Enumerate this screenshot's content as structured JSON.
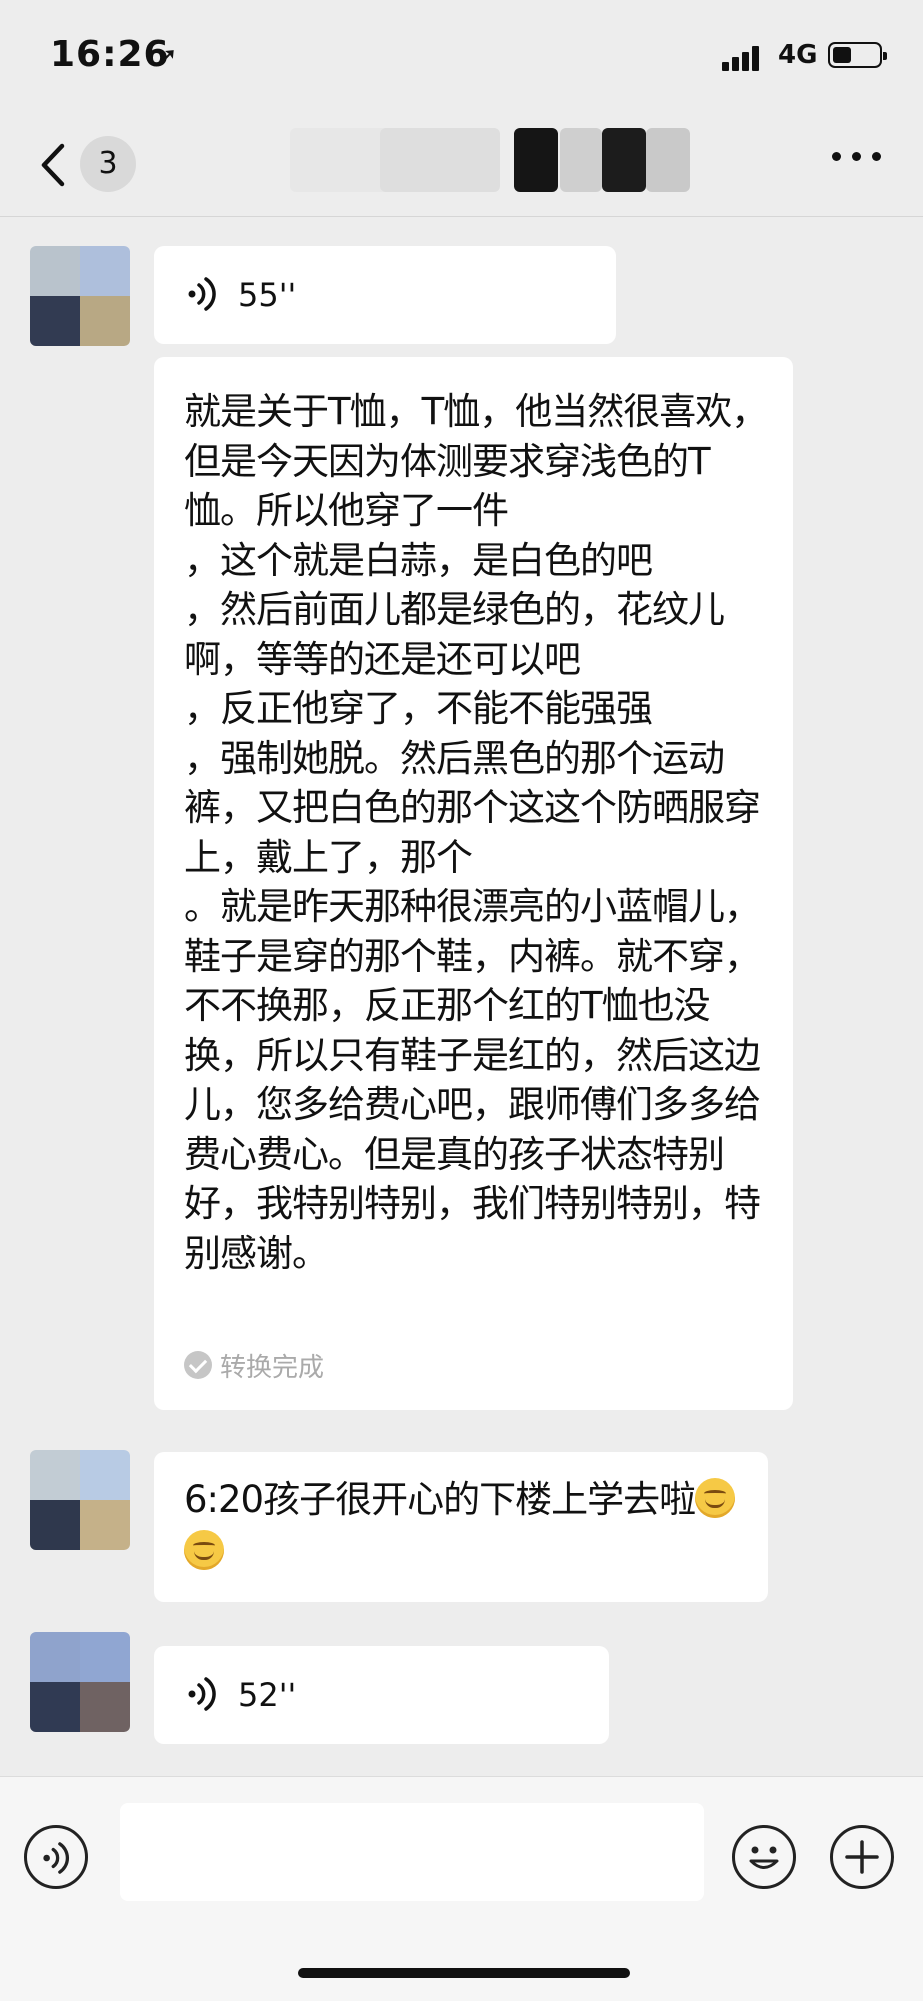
{
  "status_bar": {
    "time": "16:26",
    "location_glyph": "➚",
    "network": "4G",
    "icons": [
      "location-arrow-icon",
      "signal-icon",
      "battery-icon"
    ]
  },
  "nav": {
    "unread_count": "3",
    "icons": [
      "back-chevron-icon",
      "more-icon"
    ]
  },
  "messages": {
    "voice1_duration": "55''",
    "transcript_text": "就是关于T恤，T恤，他当然很喜欢，但是今天因为体测要求穿浅色的T恤。所以他穿了一件\n，这个就是白蒜，是白色的吧\n，然后前面儿都是绿色的，花纹儿啊，等等的还是还可以吧\n，反正他穿了，不能不能强强\n，强制她脱。然后黑色的那个运动裤，又把白色的那个这这个防晒服穿上，戴上了，那个\n。就是昨天那种很漂亮的小蓝帽儿，鞋子是穿的那个鞋，内裤。就不穿，不不换那，反正那个红的T恤也没换，所以只有鞋子是红的，然后这边儿，您多给费心吧，跟师傅们多多给费心费心。但是真的孩子状态特别好，我特别特别，我们特别特别，特别感谢。",
    "transcript_status": "转换完成",
    "text_message": "6:20孩子很开心的下楼上学去啦",
    "voice2_duration": "52''"
  },
  "colors": {
    "background": "#ededed",
    "bubble": "#ffffff",
    "input_bar": "#f6f6f6",
    "muted_text": "#aaaaaa"
  }
}
